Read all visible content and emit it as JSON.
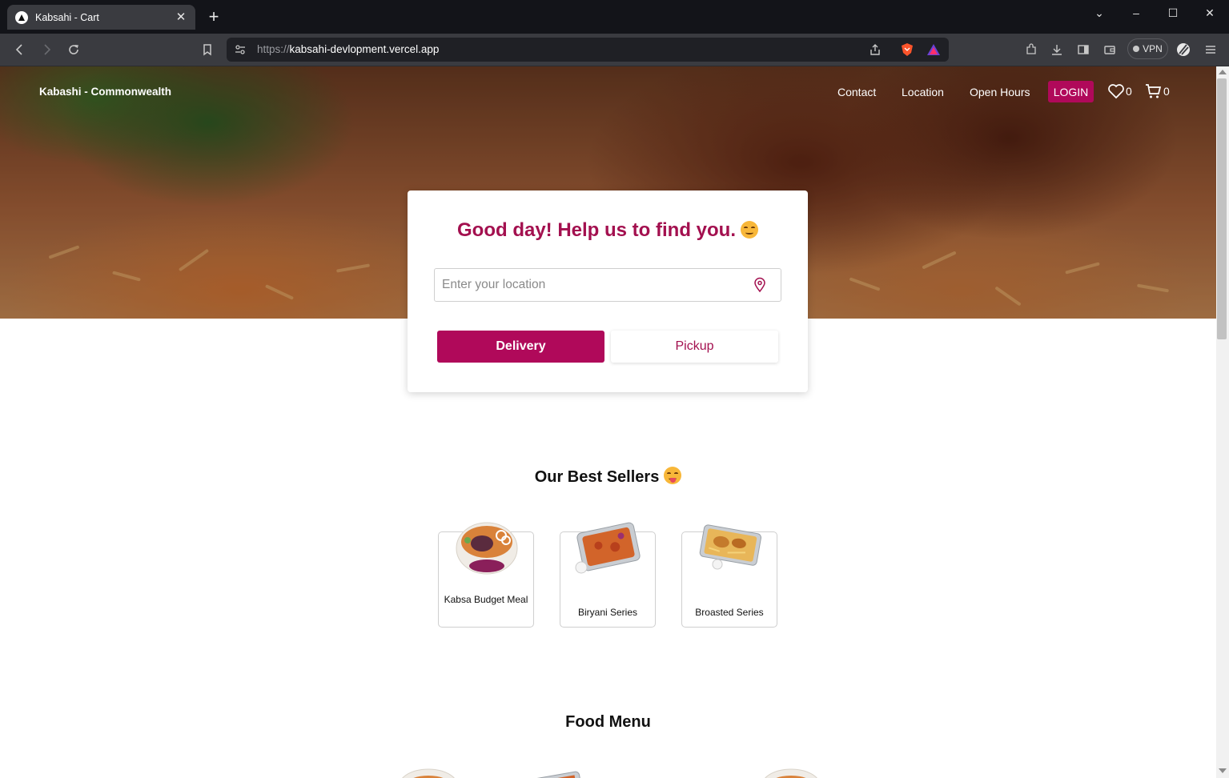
{
  "browser": {
    "tab_title": "Kabsahi - Cart",
    "tab_close": "✕",
    "new_tab": "+",
    "url_scheme": "https://",
    "url_host": "kabsahi-devlopment.vercel.app",
    "vpn_label": "VPN",
    "window_controls": [
      "⌄",
      "–",
      "☐",
      "✕"
    ]
  },
  "nav": {
    "brand": "Kabashi - Commonwealth",
    "links": [
      "Contact",
      "Location",
      "Open Hours"
    ],
    "login": "LOGIN",
    "wishlist_count": "0",
    "cart_count": "0"
  },
  "location_card": {
    "title": "Good day! Help us to find you.",
    "input_placeholder": "Enter your location",
    "input_value": "",
    "delivery_label": "Delivery",
    "pickup_label": "Pickup",
    "selected_mode": "Delivery"
  },
  "best_sellers": {
    "title": "Our Best Sellers",
    "items": [
      {
        "name": "Kabsa Budget Meal"
      },
      {
        "name": "Biryani Series"
      },
      {
        "name": "Broasted Series"
      }
    ]
  },
  "food_menu": {
    "title": "Food Menu"
  },
  "colors": {
    "brand": "#b0095a",
    "title": "#a3104f",
    "browser_dark": "#131419",
    "browser_toolbar": "#3a3b40"
  },
  "icons": {
    "tab_favicon": "triangle-logo-icon",
    "back": "back-arrow-icon",
    "forward": "forward-arrow-icon",
    "reload": "reload-icon",
    "bookmark": "bookmark-icon",
    "site_settings": "site-settings-icon",
    "share": "share-icon",
    "brave_shield": "brave-shield-icon",
    "brave_rewards": "brave-rewards-icon",
    "extensions": "extensions-icon",
    "downloads": "download-icon",
    "sidebar": "sidebar-icon",
    "wallet": "wallet-icon",
    "leo": "leo-ai-icon",
    "menu": "hamburger-menu-icon",
    "wishlist": "heart-icon",
    "cart": "cart-icon",
    "location_pin": "location-pin-icon"
  }
}
